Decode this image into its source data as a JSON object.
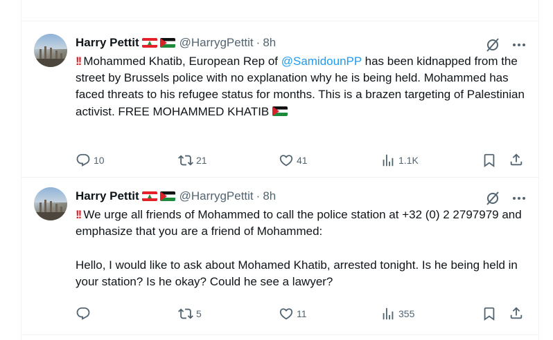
{
  "tweets": [
    {
      "author_name": "Harry Pettit",
      "author_handle": "@HarrygPettit",
      "separator": "·",
      "time": "8h",
      "text_prefix": "Mohammed Khatib, European Rep of ",
      "mention": "@SamidounPP",
      "text_suffix": " has been kidnapped from the street by Brussels police with no explanation why he is being held. Mohammed has faced threats to his refugee status for months. This is a brazen targeting of Palestinian activist. FREE MOHAMMED KHATIB ",
      "replies": "10",
      "reposts": "21",
      "likes": "41",
      "views": "1.1K"
    },
    {
      "author_name": "Harry Pettit",
      "author_handle": "@HarrygPettit",
      "separator": "·",
      "time": "8h",
      "text": "We urge all friends of Mohammed to call the police station at +32 (0) 2 2797979 and emphasize that you are a friend of Mohammed:\n\nHello, I would like to ask about Mohamed Khatib, arrested tonight. Is he being held in your station? Is he okay? Could he see a lawyer?",
      "replies": "",
      "reposts": "5",
      "likes": "11",
      "views": "355"
    }
  ],
  "icons": {
    "emphasis": "double-exclamation-icon",
    "flags": [
      "lebanon-flag-icon",
      "palestine-flag-icon"
    ],
    "actions": [
      "reply-icon",
      "repost-icon",
      "like-icon",
      "views-icon",
      "bookmark-icon",
      "share-icon",
      "grok-icon",
      "more-icon"
    ]
  },
  "colors": {
    "link": "#1d9bf0",
    "text": "#0f1419",
    "secondary": "#536471",
    "border": "#eff3f4"
  }
}
